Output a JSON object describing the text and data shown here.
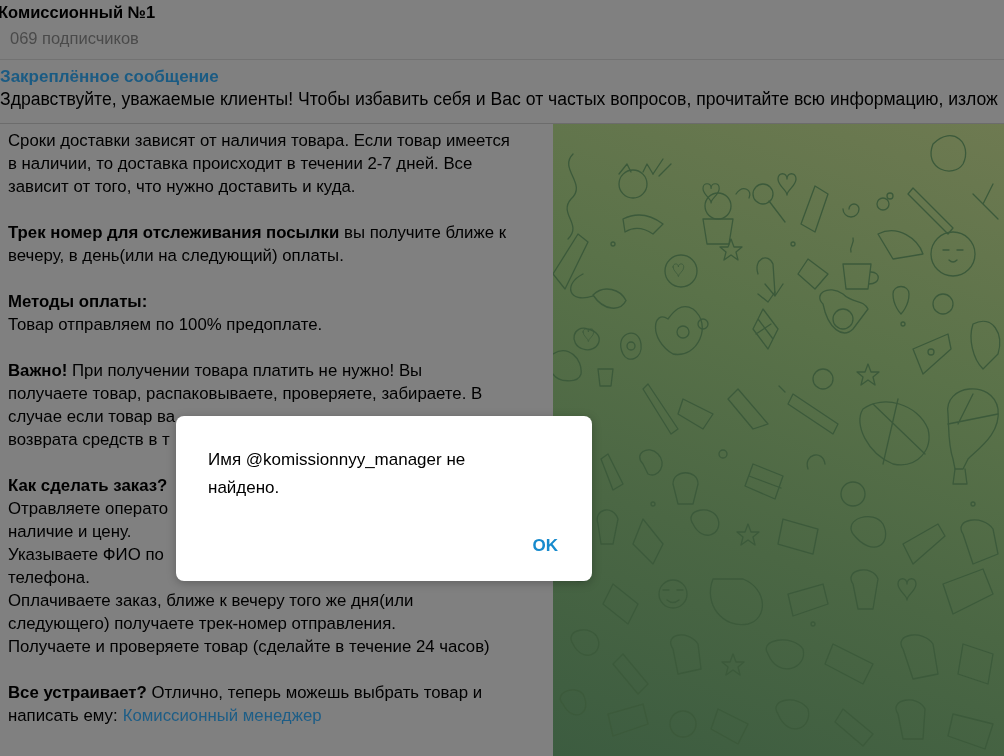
{
  "header": {
    "title": "Комиссионный №1",
    "subtitle": "069 подписчиков"
  },
  "pinned_message": {
    "label": "Закреплённое сообщение",
    "text": "Здравствуйте, уважаемые клиенты! Чтобы избавить себя и Вас от частых вопросов, прочитайте всю информацию, излож"
  },
  "message": {
    "paragraphs": [
      {
        "lines": [
          {
            "kind": "text",
            "text": "Сроки доставки зависят от наличия товара. Если товар имеется"
          },
          {
            "kind": "text",
            "text": "в наличии, то доставка происходит в течении 2-7 дней. Все"
          },
          {
            "kind": "text",
            "text": "зависит от того, что нужно доставить и куда."
          }
        ]
      },
      {
        "lines": [
          {
            "kind": "text",
            "text": "**Трек номер для отслеживания посылки** вы получите ближе к"
          },
          {
            "kind": "text",
            "text": "вечеру, в день(или на следующий) оплаты."
          }
        ]
      },
      {
        "lines": [
          {
            "kind": "heading",
            "text": "Методы оплаты:"
          },
          {
            "kind": "text",
            "text": "Товар отправляем по 100% предоплате."
          }
        ]
      },
      {
        "lines": [
          {
            "kind": "text",
            "text": "**Важно!** При получении товара платить не нужно! Вы"
          },
          {
            "kind": "text",
            "text": "получаете товар, распаковываете, проверяете, забираете. В"
          },
          {
            "kind": "text",
            "text": "случае если товар ва"
          },
          {
            "kind": "text",
            "text": "возврата средств в т"
          }
        ]
      },
      {
        "lines": [
          {
            "kind": "heading",
            "text": "Как сделать заказ?"
          },
          {
            "kind": "text",
            "text": "Отравляете операто"
          },
          {
            "kind": "text",
            "text": "наличие и цену."
          },
          {
            "kind": "text",
            "text": "Указываете ФИО по"
          },
          {
            "kind": "text",
            "text": "телефона."
          },
          {
            "kind": "text",
            "text": "Оплачиваете заказ, ближе к вечеру того же дня(или"
          },
          {
            "kind": "text",
            "text": "следующего) получаете трек-номер отправления."
          },
          {
            "kind": "text",
            "text": "Получаете и проверяете товар (сделайте в течение 24 часов)"
          }
        ]
      },
      {
        "lines": [
          {
            "kind": "text",
            "text": "**Все устраивает?** Отлично, теперь можешь выбрать товар и"
          },
          {
            "kind": "text",
            "text": "написать ему:",
            "link": "Комиссионный менеджер"
          }
        ]
      }
    ]
  },
  "dialog": {
    "message": "Имя @komissionnyy_manager не найдено.",
    "buttons": [
      "OK"
    ]
  }
}
